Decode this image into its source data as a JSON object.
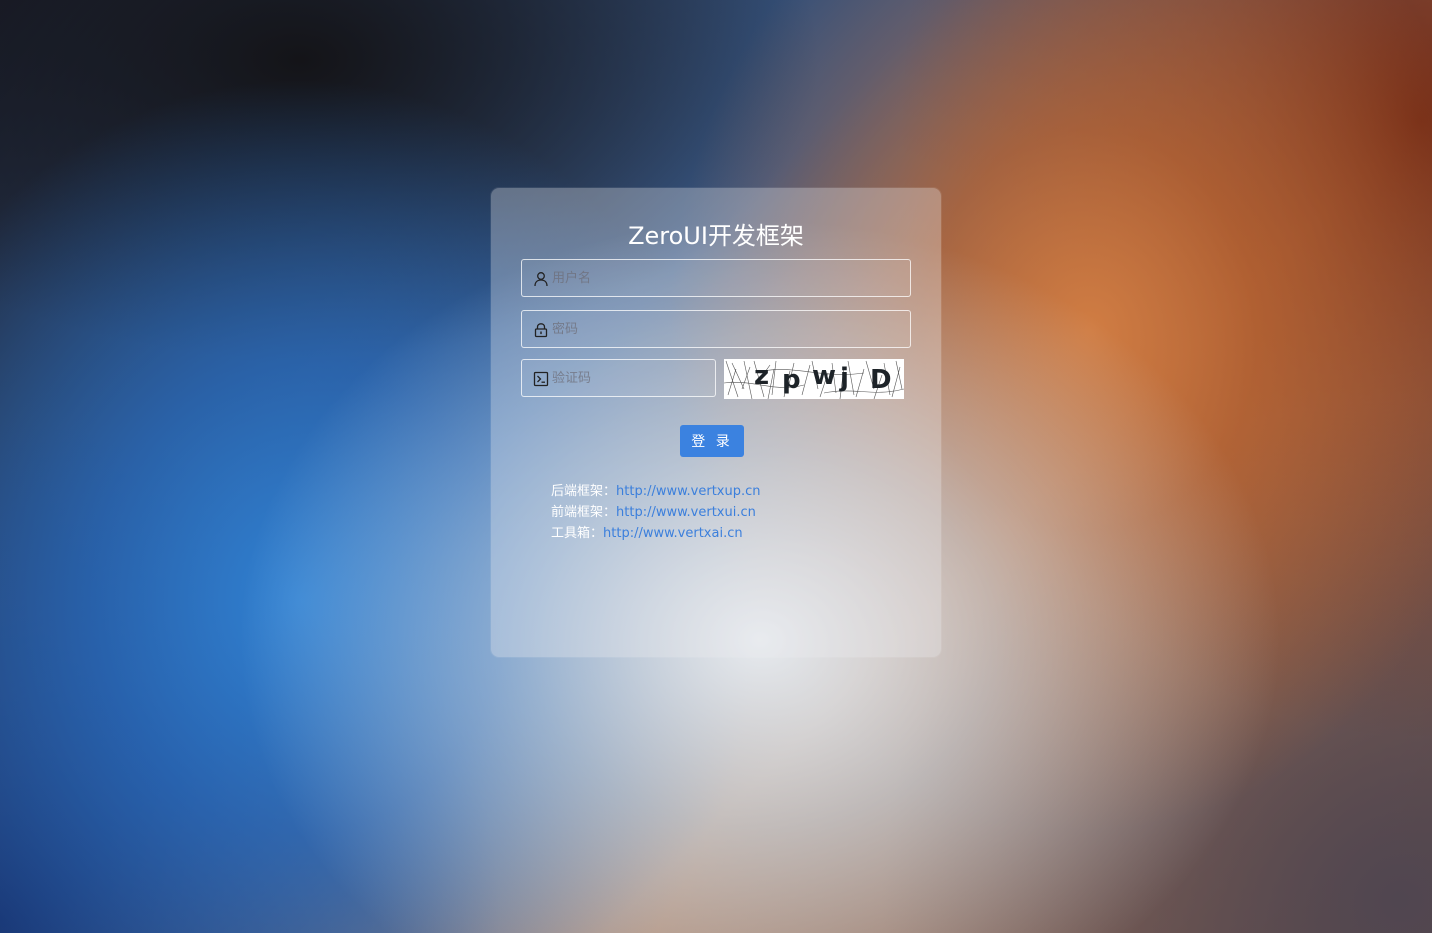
{
  "app": {
    "title": "ZeroUI开发框架"
  },
  "form": {
    "username_placeholder": "用户名",
    "password_placeholder": "密码",
    "captcha_placeholder": "验证码",
    "captcha_text": [
      "z",
      "p",
      "w",
      "j",
      "D"
    ],
    "login_label": "登 录"
  },
  "links": [
    {
      "label": "后端框架：",
      "url": "http://www.vertxup.cn"
    },
    {
      "label": "前端框架：",
      "url": "http://www.vertxui.cn"
    },
    {
      "label": "工具箱：",
      "url": "http://www.vertxai.cn"
    }
  ],
  "colors": {
    "primary": "#3b82e0",
    "link": "#3b7fdc"
  },
  "icons": {
    "username": "user-icon",
    "password": "lock-icon",
    "captcha": "terminal-icon"
  }
}
